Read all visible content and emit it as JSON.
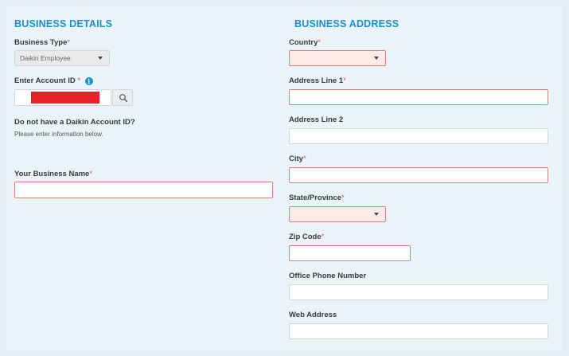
{
  "business_details": {
    "title": "BUSINESS DETAILS",
    "business_type_label": "Business Type",
    "business_type_value": "Daikin Employee",
    "account_id_label": "Enter Account ID",
    "required_mark": "*",
    "no_account_title": "Do not have a Daikin Account ID?",
    "no_account_hint": "Please enter information below.",
    "business_name_label": "Your Business Name"
  },
  "business_address": {
    "title": "BUSINESS ADDRESS",
    "country_label": "Country",
    "address1_label": "Address Line 1",
    "address2_label": "Address Line 2",
    "city_label": "City",
    "state_label": "State/Province",
    "zip_label": "Zip Code",
    "phone_label": "Office Phone Number",
    "web_label": "Web Address"
  },
  "colors": {
    "accent": "#1c8fcf",
    "error_border": "#d98278",
    "redaction": "#e8212a"
  },
  "icons": {
    "search": "search-icon",
    "info": "info-icon",
    "dropdown": "chevron-down-icon"
  }
}
